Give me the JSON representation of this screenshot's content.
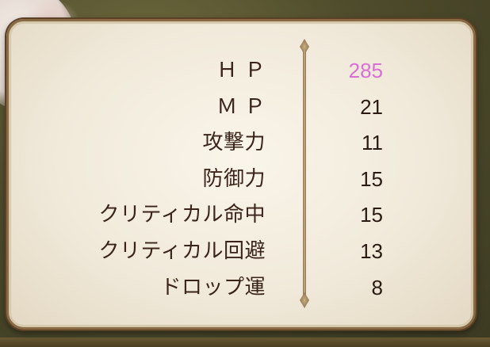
{
  "stats": [
    {
      "label": "Ｈ Ｐ",
      "value": "285",
      "highlight": true
    },
    {
      "label": "Ｍ Ｐ",
      "value": "21",
      "highlight": false
    },
    {
      "label": "攻撃力",
      "value": "11",
      "highlight": false
    },
    {
      "label": "防御力",
      "value": "15",
      "highlight": false
    },
    {
      "label": "クリティカル命中",
      "value": "15",
      "highlight": false
    },
    {
      "label": "クリティカル回避",
      "value": "13",
      "highlight": false
    },
    {
      "label": "ドロップ運",
      "value": "8",
      "highlight": false
    }
  ],
  "colors": {
    "highlight_value": "#d96fd6",
    "normal_value": "#2a1a12",
    "label": "#3a241a"
  }
}
